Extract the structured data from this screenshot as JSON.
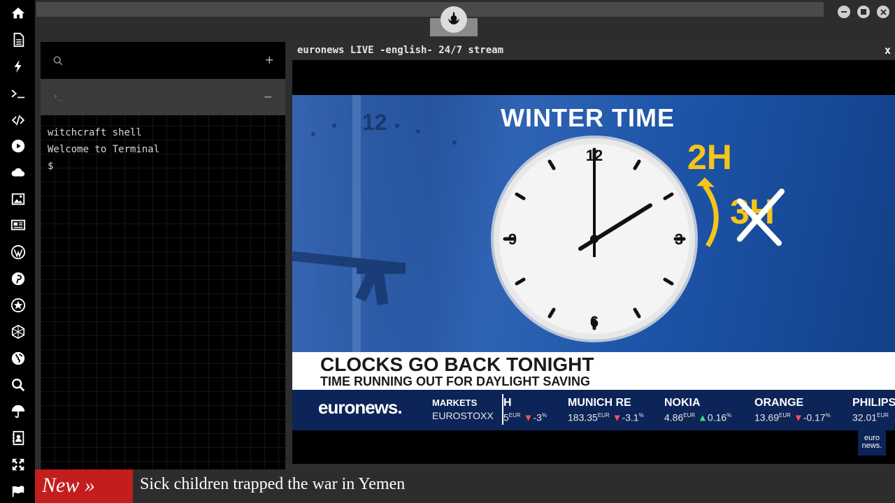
{
  "window": {
    "controls": [
      "minimize-icon",
      "maximize-icon",
      "close-icon"
    ],
    "logo_icon": "rebel-alliance-icon"
  },
  "sidebar": {
    "items": [
      {
        "icon": "home-icon"
      },
      {
        "icon": "document-icon"
      },
      {
        "icon": "bolt-icon"
      },
      {
        "icon": "terminal-icon"
      },
      {
        "icon": "code-icon"
      },
      {
        "icon": "play-circle-icon"
      },
      {
        "icon": "cloud-icon"
      },
      {
        "icon": "image-icon"
      },
      {
        "icon": "newspaper-icon"
      },
      {
        "icon": "wordpress-icon"
      },
      {
        "icon": "pinterest-icon"
      },
      {
        "icon": "aperture-icon"
      },
      {
        "icon": "hexagon-network-icon"
      },
      {
        "icon": "globe-icon"
      },
      {
        "icon": "search-icon"
      },
      {
        "icon": "umbrella-icon"
      },
      {
        "icon": "contacts-icon"
      },
      {
        "icon": "expand-arrows-icon"
      },
      {
        "icon": "flag-icon"
      }
    ]
  },
  "terminal": {
    "search_icon": "search-icon",
    "add_label": "+",
    "tab_prompt": "›_",
    "collapse_label": "−",
    "lines": [
      "witchcraft shell",
      "Welcome to Terminal",
      "$"
    ]
  },
  "video": {
    "title": "euronews LIVE -english- 24/7 stream",
    "close_label": "x",
    "graphic": {
      "heading": "WINTER TIME",
      "new_time": "2H",
      "old_time": "3H",
      "clock_numbers": [
        "12",
        "3",
        "6",
        "9"
      ],
      "bg_clock_number": "12"
    },
    "headline": {
      "main": "CLOCKS GO BACK TONIGHT",
      "sub": "TIME RUNNING OUT FOR DAYLIGHT SAVING"
    },
    "ticker": {
      "brand": "euronews.",
      "markets_label": "MARKETS",
      "markets_index": "EUROSTOXX",
      "items": [
        {
          "name": "H",
          "value": "5",
          "unit": "EUR",
          "change": "-3",
          "dir": "down"
        },
        {
          "name": "MUNICH RE",
          "value": "183.35",
          "unit": "EUR",
          "change": "-3.1",
          "dir": "down"
        },
        {
          "name": "NOKIA",
          "value": "4.86",
          "unit": "EUR",
          "change": "0.16",
          "dir": "up"
        },
        {
          "name": "ORANGE",
          "value": "13.69",
          "unit": "EUR",
          "change": "-0.17",
          "dir": "down"
        },
        {
          "name": "PHILIPS",
          "value": "32.01",
          "unit": "EUR",
          "change": "",
          "dir": "none"
        }
      ],
      "percent_sign": "%"
    },
    "corner_logo": "euro news."
  },
  "news": {
    "tag": "New »",
    "text": "Sick children trapped the war in Yemen"
  },
  "colors": {
    "accent_red": "#c41d1d",
    "clock_gold": "#f5c51c",
    "euronews_blue": "#0c2457"
  }
}
